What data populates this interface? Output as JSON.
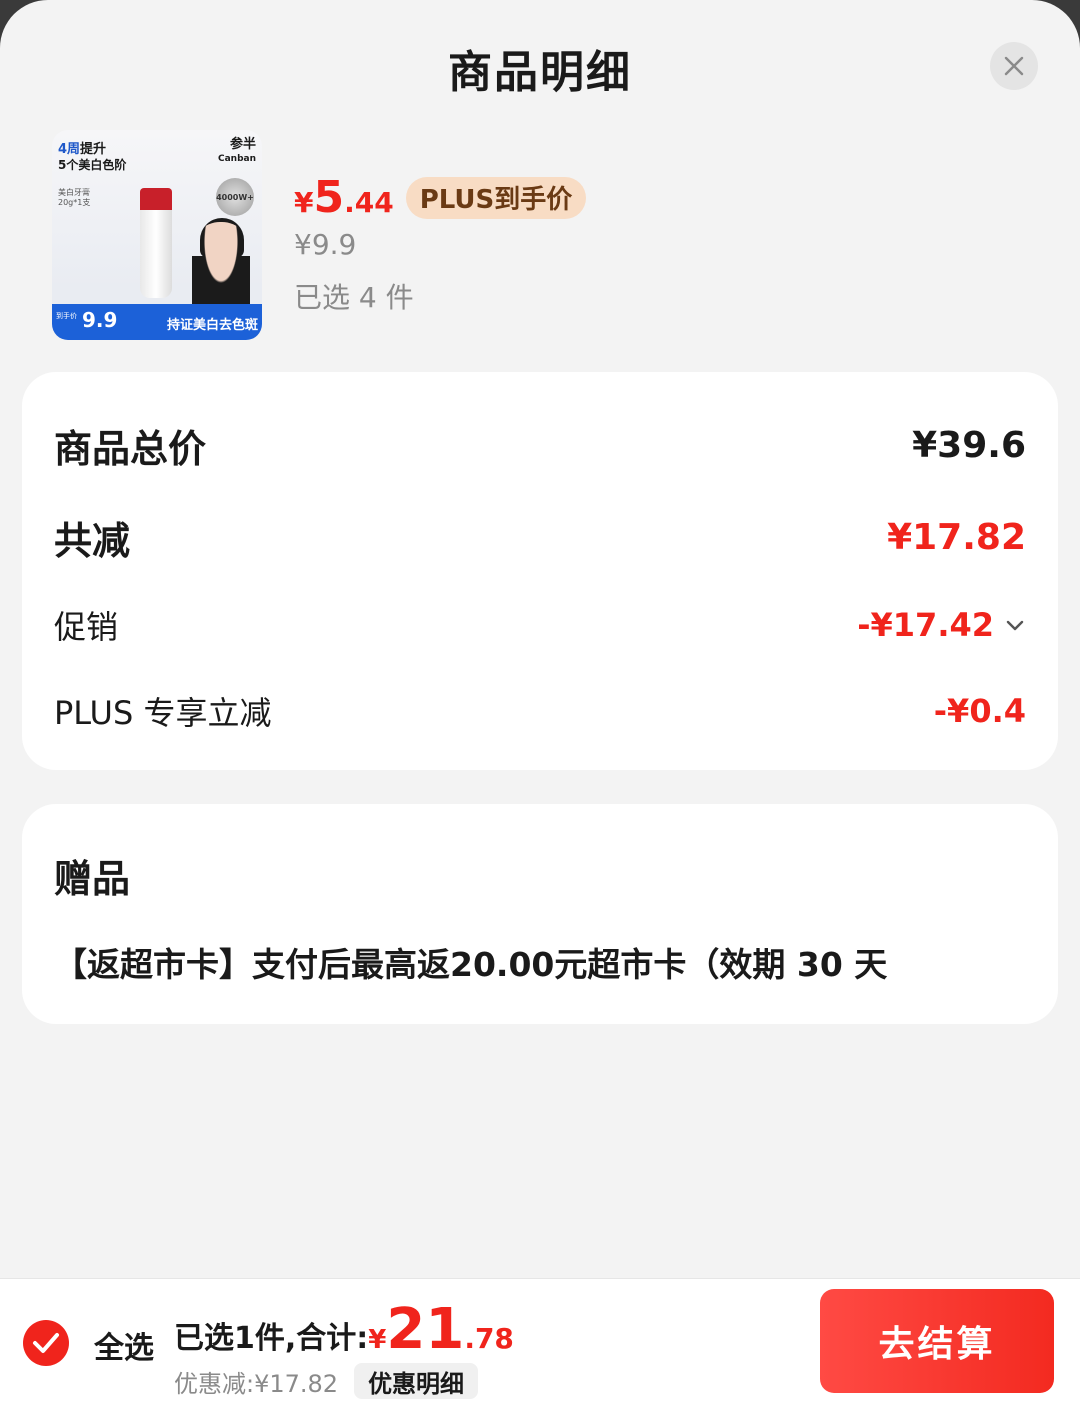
{
  "header": {
    "title": "商品明细",
    "close_icon": "close-icon"
  },
  "product": {
    "thumb": {
      "headline_blue": "4周",
      "headline_black": "提升",
      "headline2": "5个美白色阶",
      "spec": "美白牙膏\n20g*1支",
      "brand": "参半",
      "brand_en": "Canban",
      "badge": "4000W+",
      "footer_price": "9.9",
      "footer_tag": "到手价",
      "footer_slogan": "持证美白去色斑"
    },
    "price_symbol": "¥",
    "price_int": "5",
    "price_dec": ".44",
    "plus_tag": "PLUS到手价",
    "original_price": "¥9.9",
    "selected_count": "已选 4 件"
  },
  "summary": {
    "total_label": "商品总价",
    "total_value": "¥39.6",
    "reduce_label": "共减",
    "reduce_value": "¥17.82",
    "promo_label": "促销",
    "promo_value": "-¥17.42",
    "plus_label": "PLUS 专享立减",
    "plus_value": "-¥0.4"
  },
  "gift": {
    "title": "赠品",
    "desc": "【返超市卡】支付后最高返20.00元超市卡（效期 30 天"
  },
  "bottom": {
    "select_all": "全选",
    "total_label": "已选1件,合计:",
    "total_sym": "¥",
    "total_int": "21",
    "total_dec": ".78",
    "discount_text": "优惠减:¥17.82",
    "detail_label": "优惠明细",
    "checkout_label": "去结算"
  },
  "colors": {
    "accent_red": "#f0241c",
    "plus_tag_bg": "#f8dcc4",
    "background": "#f3f3f3"
  }
}
